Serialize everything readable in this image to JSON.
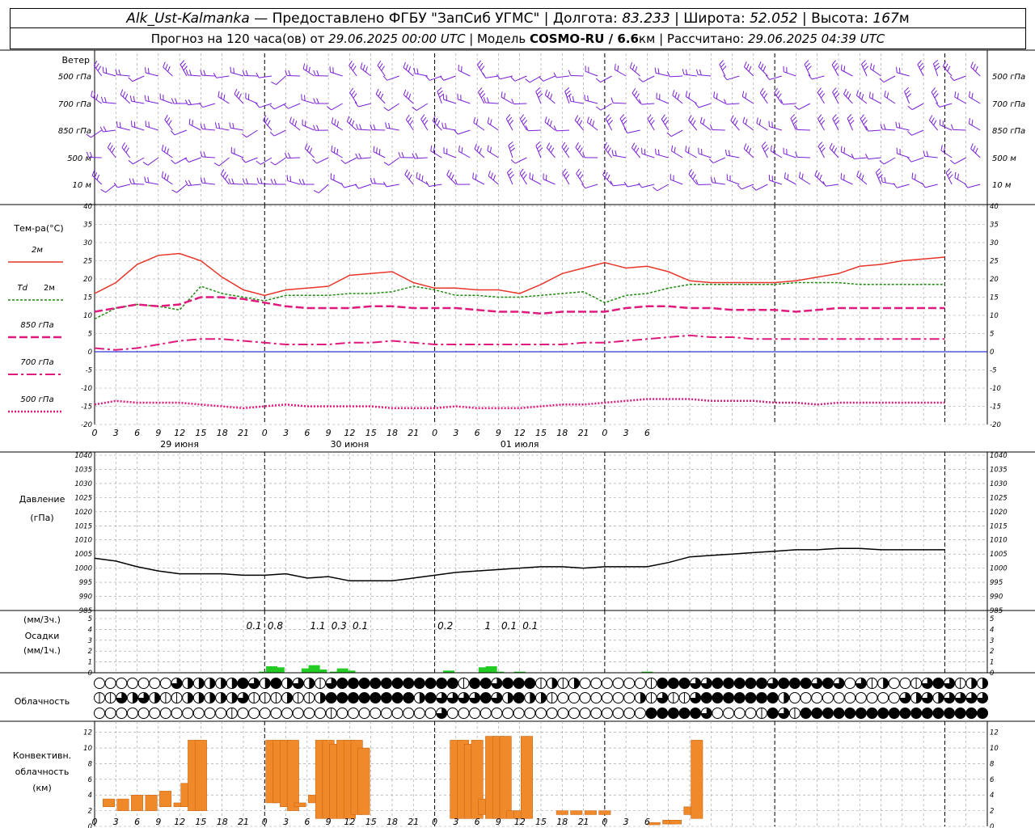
{
  "header": {
    "station": "Alk_Ust-Kalmanka",
    "dash": " — ",
    "provider": "Предоставлено ФГБУ \"ЗапСиб УГМС\"",
    "sep": " | ",
    "lon_label": "Долгота: ",
    "lon_value": "83.233",
    "lat_label": "Широта: ",
    "lat_value": "52.052",
    "alt_label": "Высота: ",
    "alt_value": "167",
    "alt_unit": "м",
    "forecast_prefix": "Прогноз на 120 часа(ов) от ",
    "forecast_start": "29.06.2025 00:00 UTC",
    "model_label": "Модель ",
    "model_name": "COSMO-RU / 6.6",
    "model_unit": "км",
    "calc_label": "Рассчитано: ",
    "calc_time": "29.06.2025 04:39 UTC"
  },
  "colors": {
    "t2m": "#e8352a",
    "td2m": "#1f8a0f",
    "t850": "#e0197d",
    "t700": "#e0197d",
    "t500": "#e0197d",
    "wind": "#7a1fd6",
    "precip": "#22cc22",
    "cloud_conv": "#f0892a",
    "pressure": "#000000",
    "zero_line": "#0000cc"
  },
  "chart_data": [
    {
      "type": "line",
      "title": "Ветер",
      "ylabels": [
        "500 гПа",
        "700 гПа",
        "850 гПа",
        "500 м",
        "10 м"
      ],
      "x_hours_step": 3,
      "note_markers": []
    },
    {
      "type": "line",
      "ylabel": "Тем-ра(°C)",
      "ylim": [
        -20,
        40
      ],
      "yticks": [
        40,
        35,
        30,
        25,
        20,
        15,
        10,
        5,
        0,
        -5,
        -10,
        -15,
        -20
      ],
      "legend": [
        {
          "key": "t2m",
          "label": "2м"
        },
        {
          "key": "td2m",
          "label_a": "Td",
          "label_b": "2м"
        },
        {
          "key": "t850",
          "label": "850 гПа"
        },
        {
          "key": "t700",
          "label": "700 гПа"
        },
        {
          "key": "t500",
          "label": "500 гПа"
        }
      ],
      "x": [
        0,
        3,
        6,
        9,
        12,
        15,
        18,
        21,
        24,
        27,
        30,
        33,
        36,
        39,
        42,
        45,
        48,
        51,
        54,
        57,
        60,
        63,
        66,
        69,
        72,
        75,
        78,
        81,
        84,
        87,
        90,
        93,
        96,
        99,
        102,
        105,
        108,
        111,
        114,
        117,
        120
      ],
      "series": [
        {
          "key": "t2m",
          "values": [
            16,
            19,
            24,
            26.5,
            27,
            25,
            20.5,
            17,
            15.5,
            17,
            17.5,
            18,
            21,
            21.5,
            22,
            19,
            17.5,
            17.5,
            17,
            17,
            16,
            18.5,
            21.5,
            23,
            24.5,
            23,
            23.5,
            22,
            19.5,
            19,
            19,
            19,
            19,
            19.5,
            20.5,
            21.5,
            23.5,
            24,
            25,
            25.5,
            26
          ]
        },
        {
          "key": "td2m",
          "values": [
            9,
            12,
            13,
            12.5,
            11.5,
            18,
            16,
            15,
            14,
            15.5,
            15.5,
            15.5,
            16,
            16,
            16.5,
            18,
            17,
            15.5,
            15.5,
            15,
            15,
            15.5,
            16,
            16.5,
            13.5,
            15.5,
            16,
            17.5,
            18.5,
            18.5,
            18.5,
            18.5,
            18.5,
            19,
            19,
            19,
            18.5,
            18.5,
            18.5,
            18.5,
            18.5
          ]
        },
        {
          "key": "t850",
          "values": [
            11,
            12,
            13,
            12.5,
            13,
            15,
            15,
            14.5,
            13.5,
            12.5,
            12,
            12,
            12,
            12.5,
            12.5,
            12,
            12,
            12,
            11.5,
            11,
            11,
            10.5,
            11,
            11,
            11,
            12,
            12.5,
            12.5,
            12,
            12,
            11.5,
            11.5,
            11.5,
            11,
            11.5,
            12,
            12,
            12,
            12,
            12,
            12
          ]
        },
        {
          "key": "t700",
          "values": [
            1,
            0.5,
            1,
            2,
            3,
            3.5,
            3.5,
            3,
            2.5,
            2,
            2,
            2,
            2.5,
            2.5,
            3,
            2.5,
            2,
            2,
            2,
            2,
            2,
            2,
            2,
            2.5,
            2.5,
            3,
            3.5,
            4,
            4.5,
            4,
            4,
            3.5,
            3.5,
            3.5,
            3.5,
            3.5,
            3.5,
            3.5,
            3.5,
            3.5,
            3.5
          ]
        },
        {
          "key": "t500",
          "values": [
            -14.5,
            -13.5,
            -14,
            -14,
            -14,
            -14.5,
            -15,
            -15.5,
            -15,
            -14.5,
            -15,
            -15,
            -15,
            -15,
            -15.5,
            -15.5,
            -15.5,
            -15,
            -15.5,
            -15.5,
            -15.5,
            -15,
            -14.5,
            -14.5,
            -14,
            -13.5,
            -13,
            -13,
            -13,
            -13.5,
            -13.5,
            -13.5,
            -14,
            -14,
            -14.5,
            -14,
            -14,
            -14,
            -14,
            -14,
            -14
          ]
        }
      ]
    },
    {
      "type": "line",
      "ylabel": "Давление",
      "ylabel2": "(гПа)",
      "ylim": [
        985,
        1040
      ],
      "yticks": [
        1040,
        1035,
        1030,
        1025,
        1020,
        1015,
        1010,
        1005,
        1000,
        995,
        990,
        985
      ],
      "x": [
        0,
        3,
        6,
        9,
        12,
        15,
        18,
        21,
        24,
        27,
        30,
        33,
        36,
        39,
        42,
        45,
        48,
        51,
        54,
        57,
        60,
        63,
        66,
        69,
        72,
        75,
        78,
        81,
        84,
        87,
        90,
        93,
        96,
        99,
        102,
        105,
        108,
        111,
        114,
        117,
        120
      ],
      "series": [
        {
          "key": "pressure",
          "values": [
            1003.5,
            1002.5,
            1000.5,
            999,
            998,
            998,
            998,
            997.5,
            997.5,
            998,
            996.5,
            997,
            995.5,
            995.5,
            995.5,
            996.5,
            997.5,
            998.5,
            999,
            999.5,
            1000,
            1000.5,
            1000.5,
            1000,
            1000.5,
            1000.5,
            1000.5,
            1002,
            1004,
            1004.5,
            1005,
            1005.5,
            1006,
            1006.5,
            1006.5,
            1007,
            1007,
            1006.5,
            1006.5,
            1006.5,
            1006.5
          ]
        }
      ]
    },
    {
      "type": "bar",
      "ylabel": "(мм/3ч.)",
      "ylabel2": "Осадки",
      "ylabel3": "(мм/1ч.)",
      "ylim": [
        0,
        5
      ],
      "yticks": [
        5,
        4,
        3,
        2,
        1,
        0
      ],
      "labels_3h": [
        {
          "x": 22.5,
          "text": "0.1"
        },
        {
          "x": 25.5,
          "text": "0.8"
        },
        {
          "x": 31.5,
          "text": "1.1"
        },
        {
          "x": 34.5,
          "text": "0.3"
        },
        {
          "x": 37.5,
          "text": "0.1"
        },
        {
          "x": 49.5,
          "text": "0.2"
        },
        {
          "x": 55.5,
          "text": "1"
        },
        {
          "x": 58.5,
          "text": "0.1"
        },
        {
          "x": 61.5,
          "text": "0.1"
        }
      ],
      "bars_1h": [
        {
          "x": 24,
          "v": 0.1
        },
        {
          "x": 25,
          "v": 0.6
        },
        {
          "x": 26,
          "v": 0.5
        },
        {
          "x": 30,
          "v": 0.4
        },
        {
          "x": 31,
          "v": 0.7
        },
        {
          "x": 32,
          "v": 0.3
        },
        {
          "x": 34,
          "v": 0.1
        },
        {
          "x": 35,
          "v": 0.4
        },
        {
          "x": 36,
          "v": 0.2
        },
        {
          "x": 50,
          "v": 0.2
        },
        {
          "x": 55,
          "v": 0.5
        },
        {
          "x": 56,
          "v": 0.6
        },
        {
          "x": 57,
          "v": 0.1
        },
        {
          "x": 60,
          "v": 0.1
        },
        {
          "x": 78,
          "v": 0.1
        }
      ]
    },
    {
      "type": "table",
      "ylabel": "Облачность",
      "note": "three rows of cloud-cover circles (0 = empty, 4 = full)",
      "rows": [
        [
          0,
          0,
          0,
          0,
          0,
          0,
          0,
          3,
          2,
          2,
          2,
          2,
          2,
          4,
          3,
          2,
          4,
          2,
          3,
          2,
          1,
          3,
          4,
          4,
          4,
          4,
          4,
          4,
          4,
          4,
          4,
          4,
          4,
          1,
          4,
          4,
          3,
          4,
          4,
          4,
          1,
          2,
          1,
          2,
          0,
          0,
          0,
          0,
          0,
          0,
          1,
          4,
          4,
          4,
          3,
          3,
          4,
          4,
          4,
          4,
          4,
          3,
          4,
          4,
          4,
          3,
          4,
          3,
          0,
          3,
          1,
          2,
          0,
          0,
          1,
          3,
          4,
          3,
          1,
          2,
          2
        ],
        [
          1,
          1,
          3,
          2,
          3,
          2,
          1,
          1,
          2,
          2,
          2,
          2,
          2,
          3,
          1,
          1,
          1,
          2,
          1,
          1,
          2,
          4,
          4,
          4,
          4,
          4,
          4,
          4,
          4,
          2,
          4,
          3,
          3,
          3,
          3,
          4,
          3,
          2,
          4,
          2,
          2,
          1,
          0,
          0,
          0,
          0,
          0,
          0,
          0,
          2,
          1,
          3,
          1,
          1,
          3,
          4,
          4,
          4,
          4,
          4,
          4,
          4,
          2,
          0,
          0,
          0,
          0,
          0,
          0,
          0,
          0,
          0,
          0,
          3,
          2,
          3,
          2,
          3,
          3,
          3,
          3
        ],
        [
          0,
          0,
          0,
          0,
          0,
          0,
          0,
          0,
          0,
          0,
          0,
          0,
          1,
          0,
          0,
          0,
          0,
          0,
          0,
          0,
          0,
          1,
          0,
          0,
          0,
          0,
          0,
          0,
          0,
          0,
          0,
          3,
          0,
          0,
          0,
          0,
          0,
          0,
          0,
          0,
          0,
          0,
          0,
          0,
          0,
          0,
          0,
          0,
          0,
          0,
          4,
          4,
          4,
          4,
          4,
          3,
          0,
          0,
          0,
          0,
          1,
          4,
          3,
          1,
          4,
          4,
          4,
          4,
          4,
          4,
          4,
          4,
          4,
          4,
          4,
          4,
          4,
          4,
          4,
          4,
          4
        ]
      ]
    },
    {
      "type": "bar",
      "ylabel": "Конвективн.",
      "ylabel2": "облачность",
      "ylabel3": "(км)",
      "ylim": [
        0,
        13
      ],
      "yticks": [
        12,
        10,
        8,
        6,
        4,
        2,
        0
      ],
      "bars": [
        {
          "x": 2,
          "top": 3.5,
          "base": 2.5
        },
        {
          "x": 4,
          "top": 3.5,
          "base": 2
        },
        {
          "x": 6,
          "top": 4,
          "base": 2
        },
        {
          "x": 8,
          "top": 4,
          "base": 2
        },
        {
          "x": 10,
          "top": 4.5,
          "base": 2.5
        },
        {
          "x": 12,
          "top": 3,
          "base": 2.5
        },
        {
          "x": 13,
          "top": 5.5,
          "base": 2.5
        },
        {
          "x": 14,
          "top": 11,
          "base": 2
        },
        {
          "x": 15,
          "top": 11,
          "base": 2
        },
        {
          "x": 25,
          "top": 11,
          "base": 3
        },
        {
          "x": 26,
          "top": 11,
          "base": 3
        },
        {
          "x": 27,
          "top": 11,
          "base": 2.5
        },
        {
          "x": 28,
          "top": 11,
          "base": 2
        },
        {
          "x": 29,
          "top": 3,
          "base": 2.5
        },
        {
          "x": 31,
          "top": 4,
          "base": 3
        },
        {
          "x": 32,
          "top": 11,
          "base": 1
        },
        {
          "x": 33,
          "top": 11,
          "base": 1
        },
        {
          "x": 34,
          "top": 10.5,
          "base": 1
        },
        {
          "x": 35,
          "top": 11,
          "base": 1
        },
        {
          "x": 36,
          "top": 11,
          "base": 1
        },
        {
          "x": 37,
          "top": 11,
          "base": 1.5
        },
        {
          "x": 38,
          "top": 10,
          "base": 1.5
        },
        {
          "x": 51,
          "top": 11,
          "base": 1
        },
        {
          "x": 52,
          "top": 11,
          "base": 1
        },
        {
          "x": 53,
          "top": 10.5,
          "base": 1
        },
        {
          "x": 54,
          "top": 11,
          "base": 1
        },
        {
          "x": 55,
          "top": 3.5,
          "base": 1.5
        },
        {
          "x": 56,
          "top": 11.5,
          "base": 1
        },
        {
          "x": 57,
          "top": 11.5,
          "base": 1
        },
        {
          "x": 58,
          "top": 11.5,
          "base": 1
        },
        {
          "x": 59,
          "top": 2,
          "base": 1
        },
        {
          "x": 60,
          "top": 2,
          "base": 1
        },
        {
          "x": 61,
          "top": 11.5,
          "base": 1
        },
        {
          "x": 66,
          "top": 2,
          "base": 1.5
        },
        {
          "x": 68,
          "top": 2,
          "base": 1.5
        },
        {
          "x": 70,
          "top": 2,
          "base": 1.5
        },
        {
          "x": 72,
          "top": 2,
          "base": 1.5
        },
        {
          "x": 79,
          "top": 0.5,
          "base": 0.2
        },
        {
          "x": 81,
          "top": 0.8,
          "base": 0.3
        },
        {
          "x": 82,
          "top": 0.8,
          "base": 0.3
        },
        {
          "x": 84,
          "top": 2.5,
          "base": 1.5
        },
        {
          "x": 85,
          "top": 11,
          "base": 1
        }
      ]
    }
  ],
  "xaxis": {
    "ticks": [
      "0",
      "3",
      "6",
      "9",
      "12",
      "15",
      "18",
      "21",
      "0",
      "3",
      "6",
      "9",
      "12",
      "15",
      "18",
      "21",
      "0",
      "3",
      "6",
      "9",
      "12",
      "15",
      "18",
      "21",
      "0",
      "3",
      "6"
    ],
    "days": [
      {
        "day_index": 0,
        "label": "29 июня"
      },
      {
        "day_index": 1,
        "label": "30 июня"
      },
      {
        "day_index": 2,
        "label": "01 июля"
      }
    ]
  }
}
